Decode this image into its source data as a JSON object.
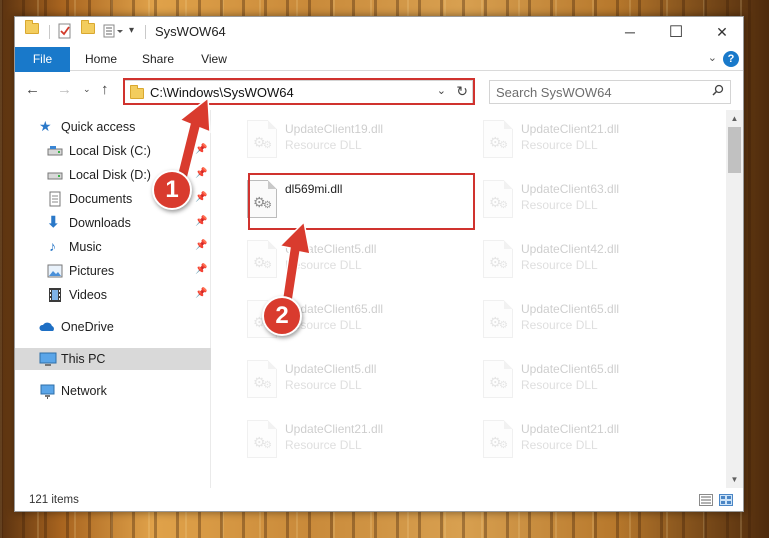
{
  "window": {
    "title": "SysWOW64",
    "controls": {
      "minimize": "─",
      "maximize": "☐",
      "close": "✕"
    }
  },
  "ribbon": {
    "tabs": [
      "File",
      "Home",
      "Share",
      "View"
    ],
    "help": "?"
  },
  "address_bar": {
    "path": "C:\\Windows\\SysWOW64",
    "search_placeholder": "Search SysWOW64"
  },
  "nav_pane": {
    "items": [
      {
        "label": "Quick access",
        "icon": "star-icon",
        "pinned": false
      },
      {
        "label": "Local Disk (C:)",
        "icon": "drive-icon",
        "pinned": true
      },
      {
        "label": "Local Disk (D:)",
        "icon": "drive-icon",
        "pinned": true
      },
      {
        "label": "Documents",
        "icon": "documents-icon",
        "pinned": true
      },
      {
        "label": "Downloads",
        "icon": "download-arrow-icon",
        "pinned": true
      },
      {
        "label": "Music",
        "icon": "music-note-icon",
        "pinned": true
      },
      {
        "label": "Pictures",
        "icon": "pictures-icon",
        "pinned": true
      },
      {
        "label": "Videos",
        "icon": "film-icon",
        "pinned": true
      },
      {
        "label": "OneDrive",
        "icon": "cloud-icon",
        "pinned": false
      },
      {
        "label": "This PC",
        "icon": "monitor-icon",
        "pinned": false,
        "selected": true
      },
      {
        "label": "Network",
        "icon": "network-icon",
        "pinned": false
      }
    ]
  },
  "files": [
    {
      "name": "UpdateClient19.dll",
      "type": "Resource DLL"
    },
    {
      "name": "UpdateClient21.dll",
      "type": "Resource DLL"
    },
    {
      "name": "dl569mi.dll",
      "type": "",
      "highlighted": true
    },
    {
      "name": "UpdateClient63.dll",
      "type": "Resource DLL"
    },
    {
      "name": "UpdateClient5.dll",
      "type": "Resource DLL"
    },
    {
      "name": "UpdateClient42.dll",
      "type": "Resource DLL"
    },
    {
      "name": "UpdateClient65.dll",
      "type": "Resource DLL"
    },
    {
      "name": "UpdateClient65.dll",
      "type": "Resource DLL"
    },
    {
      "name": "UpdateClient5.dll",
      "type": "Resource DLL"
    },
    {
      "name": "UpdateClient65.dll",
      "type": "Resource DLL"
    },
    {
      "name": "UpdateClient21.dll",
      "type": "Resource DLL"
    },
    {
      "name": "UpdateClient21.dll",
      "type": "Resource DLL"
    }
  ],
  "status": {
    "item_count": "121 items"
  },
  "annotations": {
    "step1": "1",
    "step2": "2"
  },
  "colors": {
    "accent": "#1979ca",
    "callout_red": "#d93b2e"
  }
}
